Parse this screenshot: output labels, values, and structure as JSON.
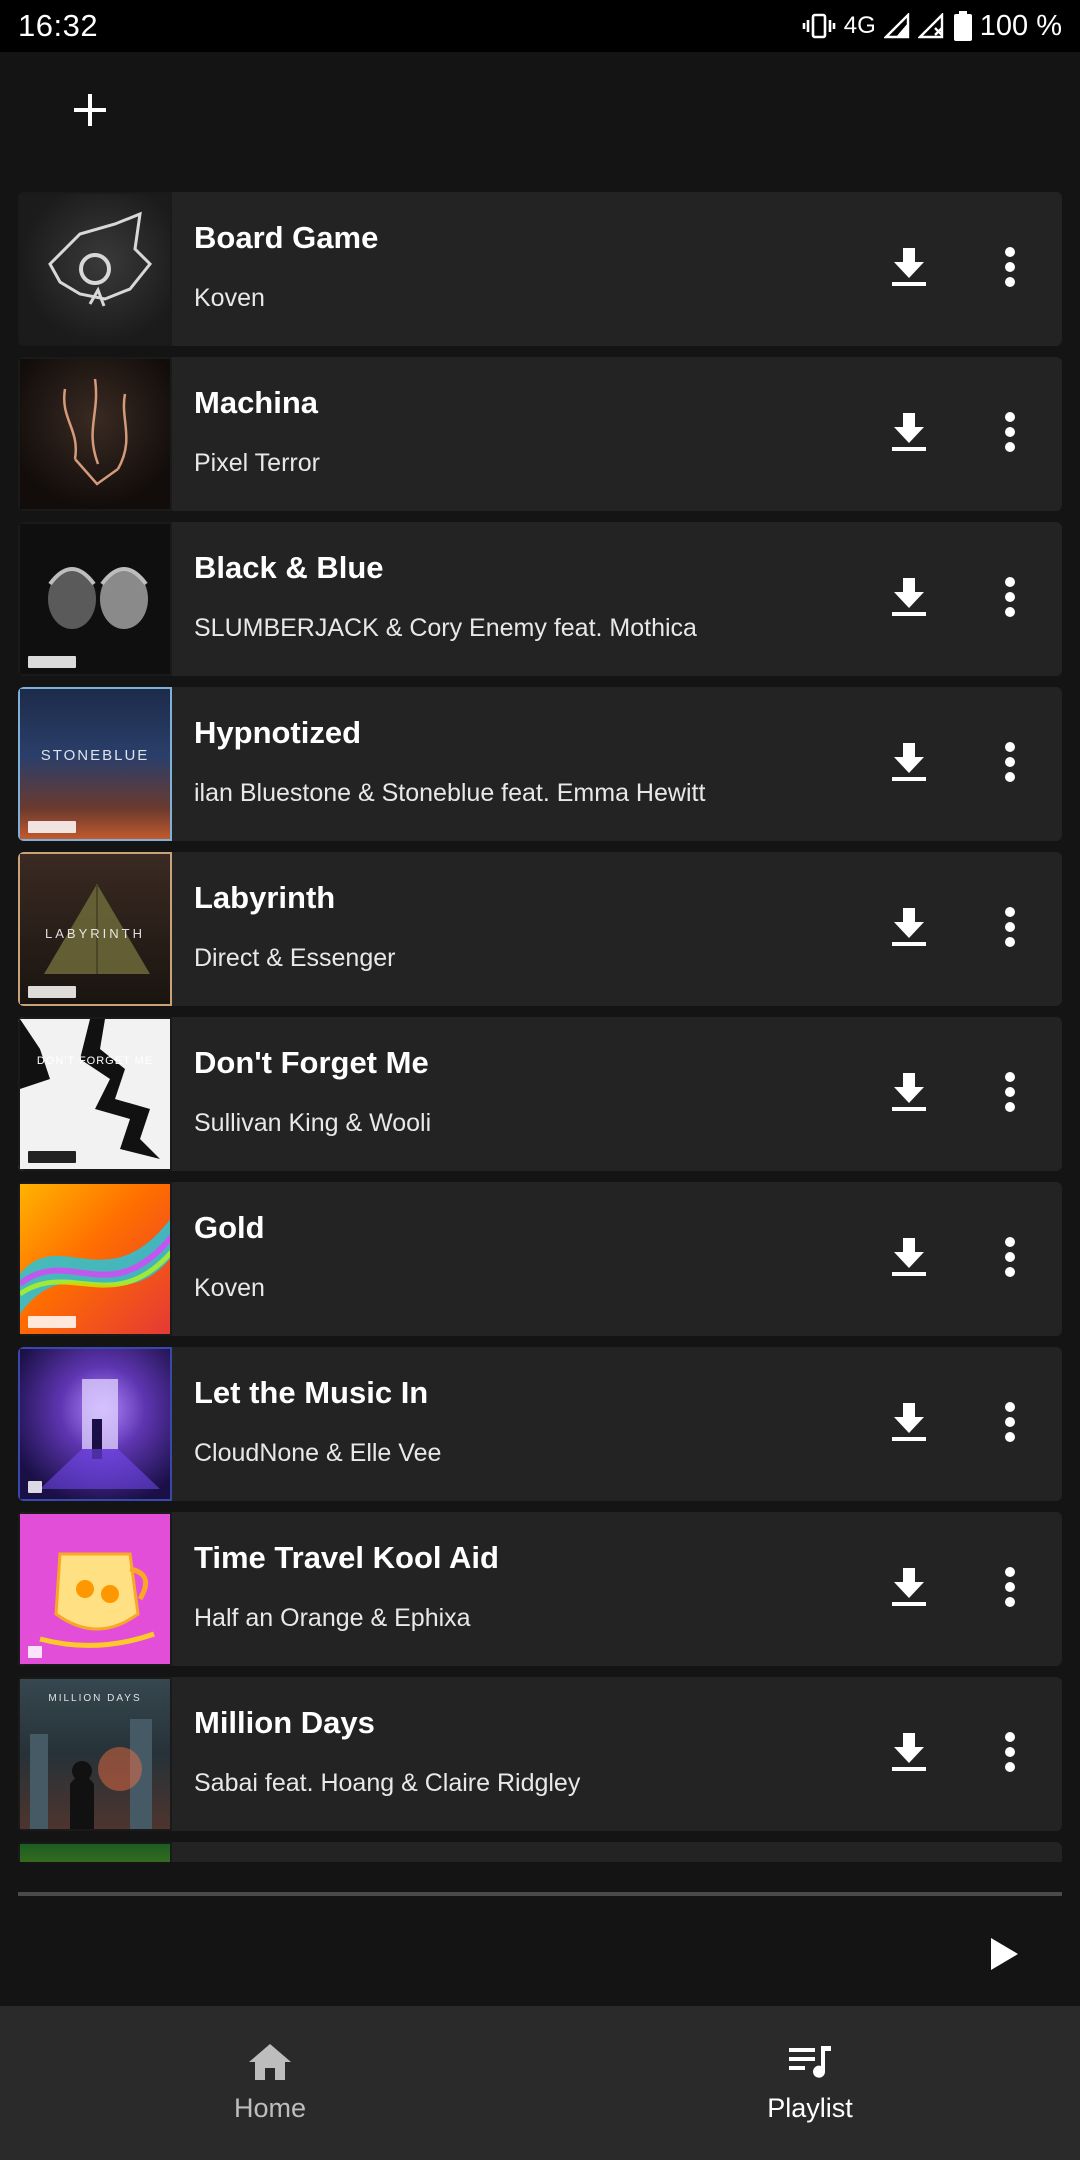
{
  "status_bar": {
    "time": "16:32",
    "network": "4G",
    "battery": "100 %"
  },
  "toolbar": {
    "add_icon": "plus-icon"
  },
  "tracks": [
    {
      "title": "Board Game",
      "artist": "Koven"
    },
    {
      "title": "Machina",
      "artist": "Pixel Terror"
    },
    {
      "title": "Black & Blue",
      "artist": "SLUMBERJACK & Cory Enemy feat. Mothica"
    },
    {
      "title": "Hypnotized",
      "artist": "ilan Bluestone & Stoneblue feat. Emma Hewitt"
    },
    {
      "title": "Labyrinth",
      "artist": "Direct & Essenger"
    },
    {
      "title": "Don't Forget Me",
      "artist": "Sullivan King & Wooli"
    },
    {
      "title": "Gold",
      "artist": "Koven"
    },
    {
      "title": "Let the Music In",
      "artist": "CloudNone & Elle Vee"
    },
    {
      "title": "Time Travel Kool Aid",
      "artist": "Half an Orange & Ephixa"
    },
    {
      "title": "Million Days",
      "artist": "Sabai feat. Hoang & Claire Ridgley"
    }
  ],
  "art_text": {
    "stoneblue": "STONEBLUE",
    "labyrinth": "LABYRINTH",
    "dont_forget_me": "DON'T FORGET ME",
    "million_days": "MILLION DAYS"
  },
  "player": {
    "progress": 0,
    "play_icon": "play-icon"
  },
  "bottom_nav": {
    "home_label": "Home",
    "playlist_label": "Playlist",
    "active": "playlist"
  },
  "colors": {
    "background": "#141414",
    "card": "#232323",
    "nav": "#2a2a2a"
  }
}
